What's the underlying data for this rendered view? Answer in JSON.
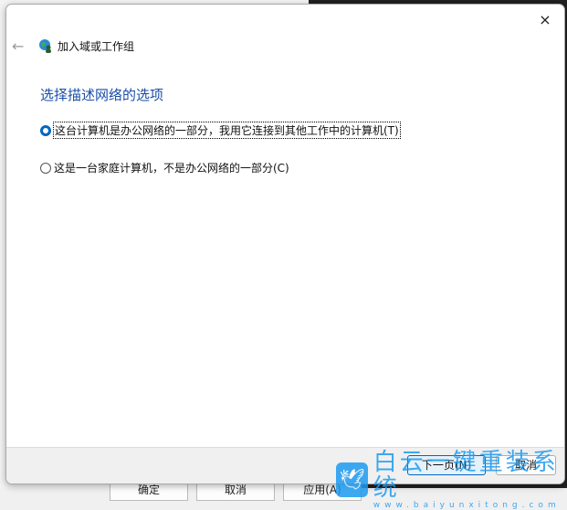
{
  "background": {
    "underlying_buttons": [
      "确定",
      "取消",
      "应用(A)"
    ]
  },
  "dialog": {
    "title": "加入域或工作组",
    "heading": "选择描述网络的选项",
    "options": [
      {
        "label": "这台计算机是办公网络的一部分，我用它连接到其他工作中的计算机(T)",
        "selected": true
      },
      {
        "label": "这是一台家庭计算机，不是办公网络的一部分(C)",
        "selected": false
      }
    ],
    "buttons": {
      "next": "下一页(N)",
      "cancel": "取消"
    },
    "close_icon": "×",
    "back_icon": "←"
  },
  "watermark": {
    "name": "白云一键重装系统",
    "url": "www.baiyunxitong.com"
  },
  "colors": {
    "accent": "#0067c0",
    "heading": "#1a4ea8",
    "watermark": "#1d9bf0"
  }
}
